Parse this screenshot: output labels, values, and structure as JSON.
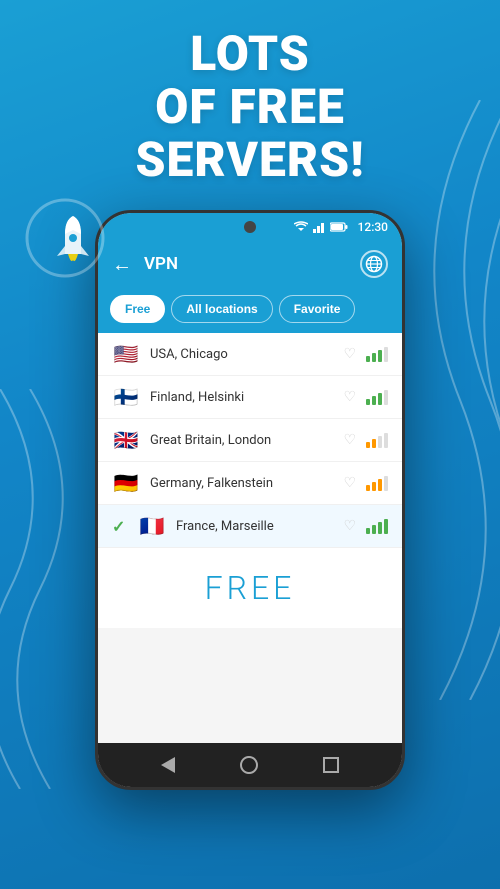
{
  "hero": {
    "line1": "Lots",
    "line2": "of free",
    "line3": "servers!"
  },
  "status_bar": {
    "time": "12:30"
  },
  "nav": {
    "title": "VPN",
    "back_icon": "←",
    "globe_icon": "🌐"
  },
  "tabs": [
    {
      "label": "Free",
      "active": true
    },
    {
      "label": "All locations",
      "active": false
    },
    {
      "label": "Favorite",
      "active": false
    }
  ],
  "servers": [
    {
      "flag": "🇺🇸",
      "name": "USA, Chicago",
      "selected": false,
      "signal": "medium"
    },
    {
      "flag": "🇫🇮",
      "name": "Finland, Helsinki",
      "selected": false,
      "signal": "medium"
    },
    {
      "flag": "🇬🇧",
      "name": "Great Britain, London",
      "selected": false,
      "signal": "medium"
    },
    {
      "flag": "🇩🇪",
      "name": "Germany, Falkenstein",
      "selected": false,
      "signal": "low"
    },
    {
      "flag": "🇫🇷",
      "name": "France, Marseille",
      "selected": true,
      "signal": "high"
    }
  ],
  "free_badge": "FREE",
  "bottom_nav": {
    "back": "◁",
    "home": "○",
    "recent": "□"
  }
}
